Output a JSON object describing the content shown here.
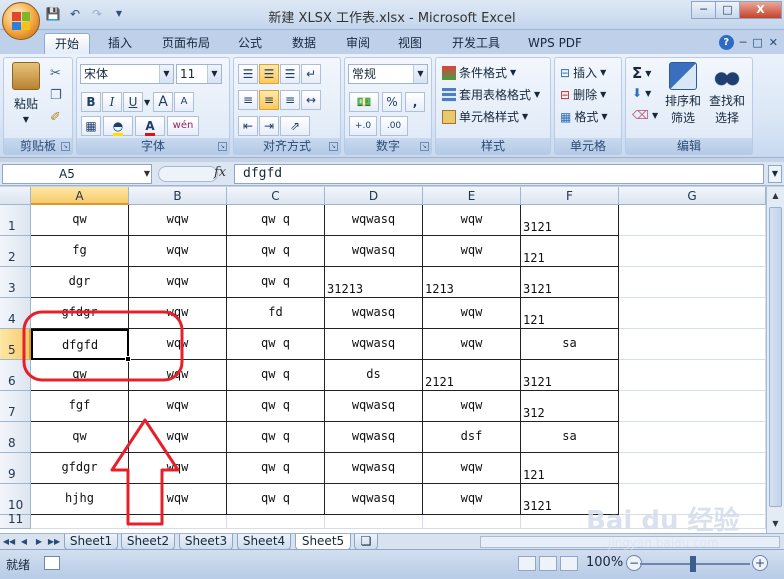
{
  "window": {
    "title": "新建 XLSX 工作表.xlsx - Microsoft Excel",
    "minimize": "─",
    "restore": "□",
    "close": "X"
  },
  "ribbon_tabs": [
    "开始",
    "插入",
    "页面布局",
    "公式",
    "数据",
    "审阅",
    "视图",
    "开发工具",
    "WPS PDF"
  ],
  "ribbon": {
    "clipboard": {
      "paste": "粘贴",
      "label": "剪贴板"
    },
    "font": {
      "name": "宋体",
      "size": "11",
      "label": "字体",
      "bold": "B",
      "italic": "I",
      "underline": "U",
      "grow": "A",
      "shrink": "A",
      "wen": "wén"
    },
    "alignment": {
      "label": "对齐方式"
    },
    "number": {
      "format": "常规",
      "label": "数字",
      "percent": "%",
      "comma": ",",
      "inc": "+.0",
      "dec": ".00"
    },
    "styles": {
      "conditional": "条件格式",
      "table": "套用表格格式",
      "cell": "单元格样式",
      "label": "样式"
    },
    "cells": {
      "insert": "插入",
      "delete": "删除",
      "format": "格式",
      "label": "单元格"
    },
    "editing": {
      "sigma": "Σ",
      "sort": "排序和",
      "sort2": "筛选",
      "find": "查找和",
      "find2": "选择",
      "label": "编辑"
    }
  },
  "formula_bar": {
    "name_box": "A5",
    "fx": "fx",
    "value": "dfgfd"
  },
  "columns": [
    "A",
    "B",
    "C",
    "D",
    "E",
    "F",
    "G"
  ],
  "rows": [
    {
      "num": "1",
      "cells": [
        "qw",
        "wqw",
        "qw q",
        "wqwasq",
        "wqw",
        "3121"
      ]
    },
    {
      "num": "2",
      "cells": [
        "fg",
        "wqw",
        "qw q",
        "wqwasq",
        "wqw",
        "121"
      ]
    },
    {
      "num": "3",
      "cells": [
        "dgr",
        "wqw",
        "qw q",
        "31213",
        "1213",
        "3121"
      ]
    },
    {
      "num": "4",
      "cells": [
        "gfdgr",
        "wqw",
        "fd",
        "wqwasq",
        "wqw",
        "121"
      ]
    },
    {
      "num": "5",
      "cells": [
        "dfgfd",
        "wqw",
        "qw q",
        "wqwasq",
        "wqw",
        "sa"
      ]
    },
    {
      "num": "6",
      "cells": [
        "qw",
        "wqw",
        "qw q",
        "ds",
        "2121",
        "3121"
      ]
    },
    {
      "num": "7",
      "cells": [
        "fgf",
        "wqw",
        "qw q",
        "wqwasq",
        "wqw",
        "312"
      ]
    },
    {
      "num": "8",
      "cells": [
        "qw",
        "wqw",
        "qw q",
        "wqwasq",
        "dsf",
        "sa"
      ]
    },
    {
      "num": "9",
      "cells": [
        "gfdgr",
        "wqw",
        "qw q",
        "wqwasq",
        "wqw",
        "121"
      ]
    },
    {
      "num": "10",
      "cells": [
        "hjhg",
        "wqw",
        "qw q",
        "wqwasq",
        "wqw",
        "3121"
      ]
    },
    {
      "num": "11",
      "cells": [
        "",
        "",
        "",
        "",
        "",
        ""
      ]
    }
  ],
  "sheets": [
    "Sheet1",
    "Sheet2",
    "Sheet3",
    "Sheet4",
    "Sheet5"
  ],
  "active_sheet": "Sheet5",
  "status": {
    "ready": "就绪",
    "zoom": "100%",
    "minus": "−",
    "plus": "+"
  },
  "watermark": {
    "brand": "Bai du 经验",
    "url": "jingyan.baidu.com"
  },
  "colors": {
    "annotation_red": "#e5202a",
    "selection_gold": "#f9c96a"
  }
}
